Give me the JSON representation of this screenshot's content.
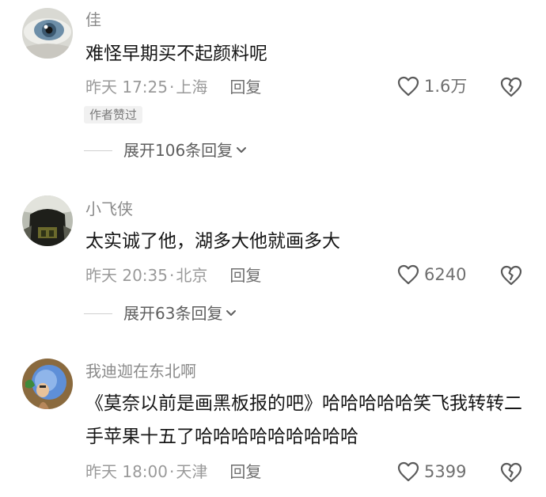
{
  "comments": [
    {
      "username": "佳",
      "text": "难怪早期买不起颜料呢",
      "time": "昨天 17:25",
      "location": "上海",
      "reply_label": "回复",
      "likes": "1.6万",
      "badge": "作者赞过",
      "expand_label": "展开106条回复"
    },
    {
      "username": "小飞侠",
      "text": "太实诚了他，湖多大他就画多大",
      "time": "昨天 20:35",
      "location": "北京",
      "reply_label": "回复",
      "likes": "6240",
      "expand_label": "展开63条回复"
    },
    {
      "username": "我迪迦在东北啊",
      "text": "《莫奈以前是画黑板报的吧》哈哈哈哈哈笑飞我转转二手苹果十五了哈哈哈哈哈哈哈哈哈",
      "time": "昨天 18:00",
      "location": "天津",
      "reply_label": "回复",
      "likes": "5399"
    }
  ],
  "separator": "·",
  "icons": {
    "like": "heart-outline-icon",
    "dislike": "broken-heart-icon",
    "expand": "chevron-down-icon"
  },
  "colors": {
    "text": "#161616",
    "secondary": "#9a9a9a",
    "badge_bg": "#f1f1f1"
  }
}
